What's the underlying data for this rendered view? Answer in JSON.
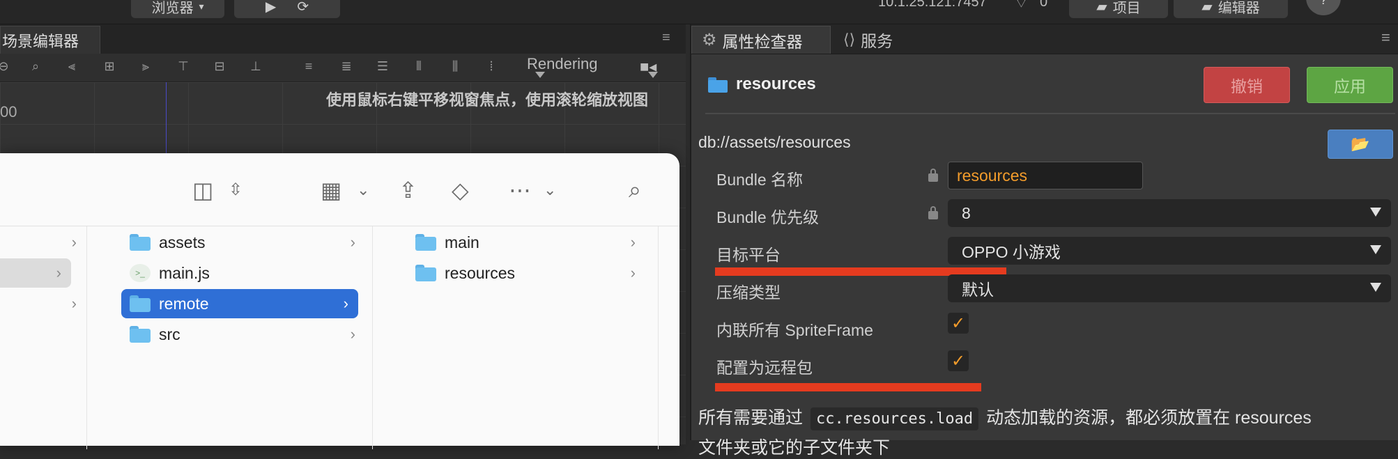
{
  "topbar": {
    "browser_label": "浏览器",
    "address": "10.1.25.121:7457",
    "wifi_count": "0",
    "project_label": "项目",
    "editor_label": "编辑器"
  },
  "scene": {
    "tab_label": "场景编辑器",
    "render_mode": "Rendering",
    "hint": "使用鼠标右键平移视窗焦点，使用滚轮缩放视图",
    "ruler_value": "00"
  },
  "finder": {
    "col2": [
      {
        "name": "assets",
        "kind": "folder",
        "selected": false
      },
      {
        "name": "main.js",
        "kind": "file",
        "selected": false
      },
      {
        "name": "remote",
        "kind": "folder",
        "selected": true
      },
      {
        "name": "src",
        "kind": "folder",
        "selected": false
      }
    ],
    "col3": [
      {
        "name": "main",
        "kind": "folder"
      },
      {
        "name": "resources",
        "kind": "folder"
      }
    ]
  },
  "inspector": {
    "tab_properties": "属性检查器",
    "tab_services": "服务",
    "asset_name": "resources",
    "revert_label": "撤销",
    "apply_label": "应用",
    "path": "db://assets/resources",
    "props": {
      "bundle_name_label": "Bundle 名称",
      "bundle_name_value": "resources",
      "priority_label": "Bundle 优先级",
      "priority_value": "8",
      "platform_label": "目标平台",
      "platform_value": "OPPO 小游戏",
      "compress_label": "压缩类型",
      "compress_value": "默认",
      "inline_label": "内联所有 SpriteFrame",
      "inline_checked": true,
      "remote_label": "配置为远程包",
      "remote_checked": true
    },
    "note_pre": "所有需要通过",
    "note_code": "cc.resources.load",
    "note_post": "动态加载的资源，都必须放置在 resources",
    "note_line2": "文件夹或它的子文件夹下"
  },
  "colors": {
    "accent_blue": "#2f6fd6",
    "revert_red": "#c24343",
    "apply_green": "#5da543",
    "highlight": "#e53b1f"
  }
}
